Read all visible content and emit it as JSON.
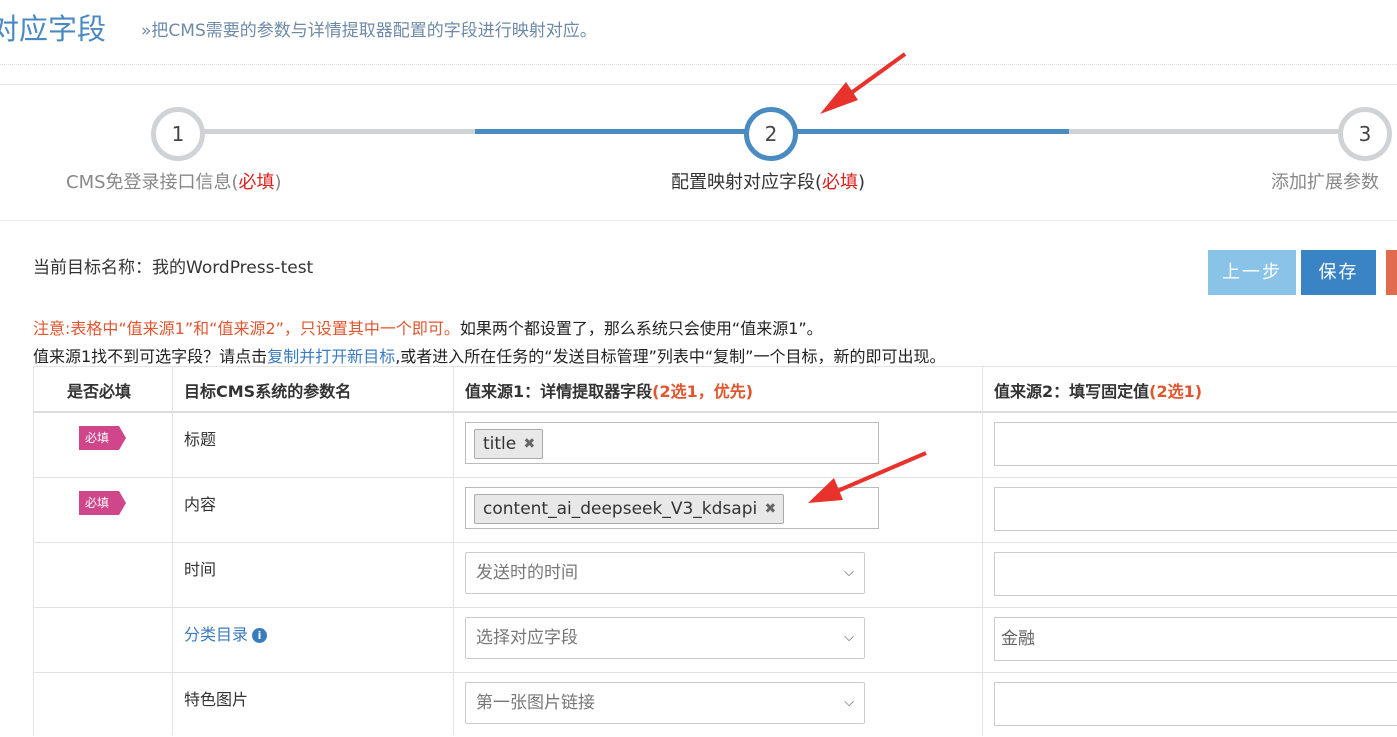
{
  "header": {
    "title": "对应字段",
    "subtitle": "»把CMS需要的参数与详情提取器配置的字段进行映射对应。"
  },
  "steps": [
    {
      "number": "1",
      "label": "CMS免登录接口信息(",
      "required": "必填",
      "suffix": ")"
    },
    {
      "number": "2",
      "label": "配置映射对应字段(",
      "required": "必填",
      "suffix": ")"
    },
    {
      "number": "3",
      "label": "添加扩展参数",
      "required": "",
      "suffix": ""
    }
  ],
  "target_name": "当前目标名称：我的WordPress-test",
  "buttons": {
    "prev": "上一步",
    "save": "保存"
  },
  "notes": {
    "warn": "注意:表格中“值来源1”和“值来源2”，只设置其中一个即可。",
    "warn_rest": "如果两个都设置了，那么系统只会使用“值来源1”。",
    "line2_prefix": "值来源1找不到可选字段？请点击",
    "line2_link": "复制并打开新目标",
    "line2_suffix": ",或者进入所在任务的“发送目标管理”列表中“复制”一个目标，新的即可出现。"
  },
  "table": {
    "headers": {
      "required": "是否必填",
      "param": "目标CMS系统的参数名",
      "source1": "值来源1：详情提取器字段",
      "source1_hint": "(2选1，优先)",
      "source2": "值来源2：填写固定值",
      "source2_hint": "(2选1)"
    },
    "badge": "必填",
    "rows": [
      {
        "required": "必填",
        "param": "标题",
        "tag": "title",
        "fixed_value": ""
      },
      {
        "required": "必填",
        "param": "内容",
        "tag": "content_ai_deepseek_V3_kdsapi",
        "fixed_value": ""
      },
      {
        "required": "",
        "param": "时间",
        "select": "发送时的时间",
        "fixed_value": ""
      },
      {
        "required": "",
        "param": "分类目录",
        "select": "选择对应字段",
        "fixed_value": "金融"
      },
      {
        "required": "",
        "param": "特色图片",
        "select": "第一张图片链接",
        "fixed_value": ""
      }
    ]
  },
  "colors": {
    "accent": "#4a8bc2",
    "required_red": "#d9221d",
    "warn_orange": "#e0562f",
    "badge_pink": "#d0468a",
    "arrow_red": "#e8332d"
  }
}
